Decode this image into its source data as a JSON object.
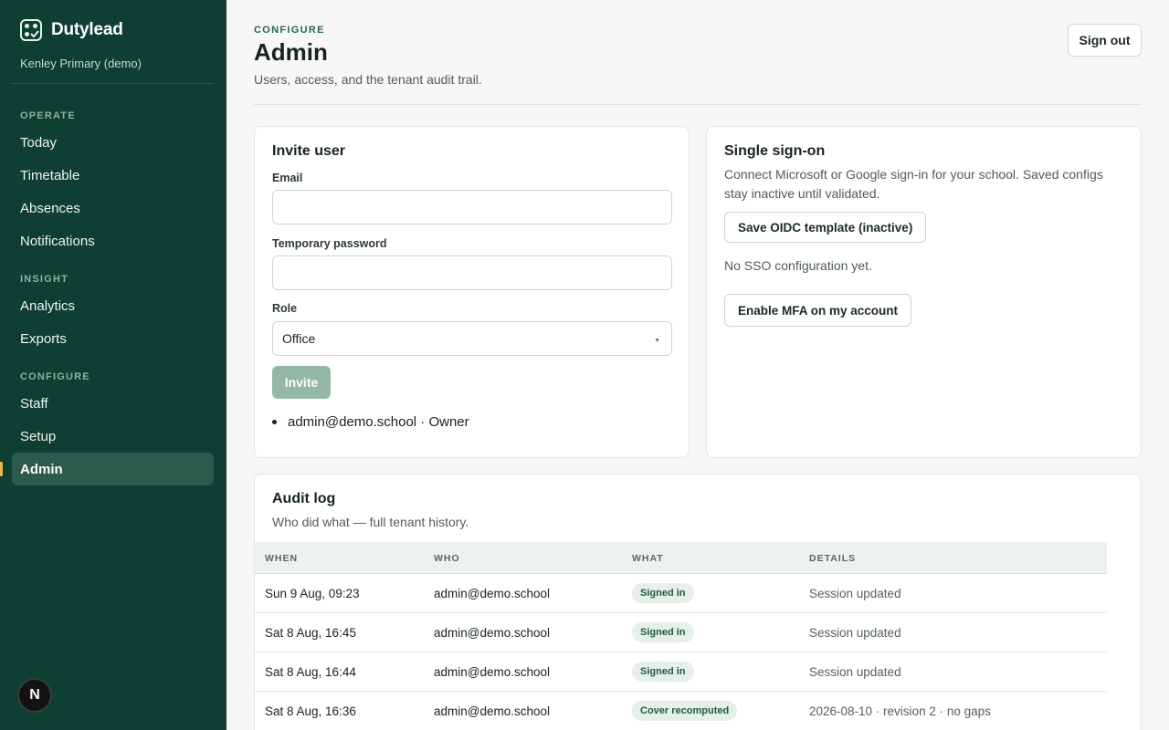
{
  "brand": {
    "name": "Dutylead",
    "tenant": "Kenley Primary (demo)"
  },
  "sidebar": {
    "sections": [
      {
        "label": "OPERATE",
        "items": [
          "Today",
          "Timetable",
          "Absences",
          "Notifications"
        ]
      },
      {
        "label": "INSIGHT",
        "items": [
          "Analytics",
          "Exports"
        ]
      },
      {
        "label": "CONFIGURE",
        "items": [
          "Staff",
          "Setup",
          "Admin"
        ]
      }
    ],
    "active_item": "Admin",
    "avatar_initial": "N"
  },
  "header": {
    "eyebrow": "CONFIGURE",
    "title": "Admin",
    "subtitle": "Users, access, and the tenant audit trail.",
    "signout_label": "Sign out"
  },
  "invite": {
    "title": "Invite user",
    "email_label": "Email",
    "email_value": "",
    "password_label": "Temporary password",
    "password_value": "",
    "role_label": "Role",
    "role_value": "Office",
    "button_label": "Invite",
    "users": [
      "admin@demo.school · Owner"
    ]
  },
  "sso": {
    "title": "Single sign-on",
    "description": "Connect Microsoft or Google sign-in for your school. Saved configs stay inactive until validated.",
    "save_button": "Save OIDC template (inactive)",
    "status": "No SSO configuration yet.",
    "mfa_button": "Enable MFA on my account"
  },
  "audit": {
    "title": "Audit log",
    "subtitle": "Who did what — full tenant history.",
    "columns": [
      "WHEN",
      "WHO",
      "WHAT",
      "DETAILS"
    ],
    "rows": [
      {
        "when": "Sun 9 Aug, 09:23",
        "who": "admin@demo.school",
        "what": "Signed in",
        "details": "Session updated"
      },
      {
        "when": "Sat 8 Aug, 16:45",
        "who": "admin@demo.school",
        "what": "Signed in",
        "details": "Session updated"
      },
      {
        "when": "Sat 8 Aug, 16:44",
        "who": "admin@demo.school",
        "what": "Signed in",
        "details": "Session updated"
      },
      {
        "when": "Sat 8 Aug, 16:36",
        "who": "admin@demo.school",
        "what": "Cover recomputed",
        "details": "2026-08-10 · revision 2 · no gaps"
      }
    ]
  },
  "icons": {
    "logo": "checklist-logo-icon",
    "caret": "chevron-down-icon"
  },
  "colors": {
    "sidebar": "#0f3f32",
    "accent": "#1f6b4f",
    "active_marker": "#f1b543",
    "invite_disabled": "#93b8a8"
  }
}
